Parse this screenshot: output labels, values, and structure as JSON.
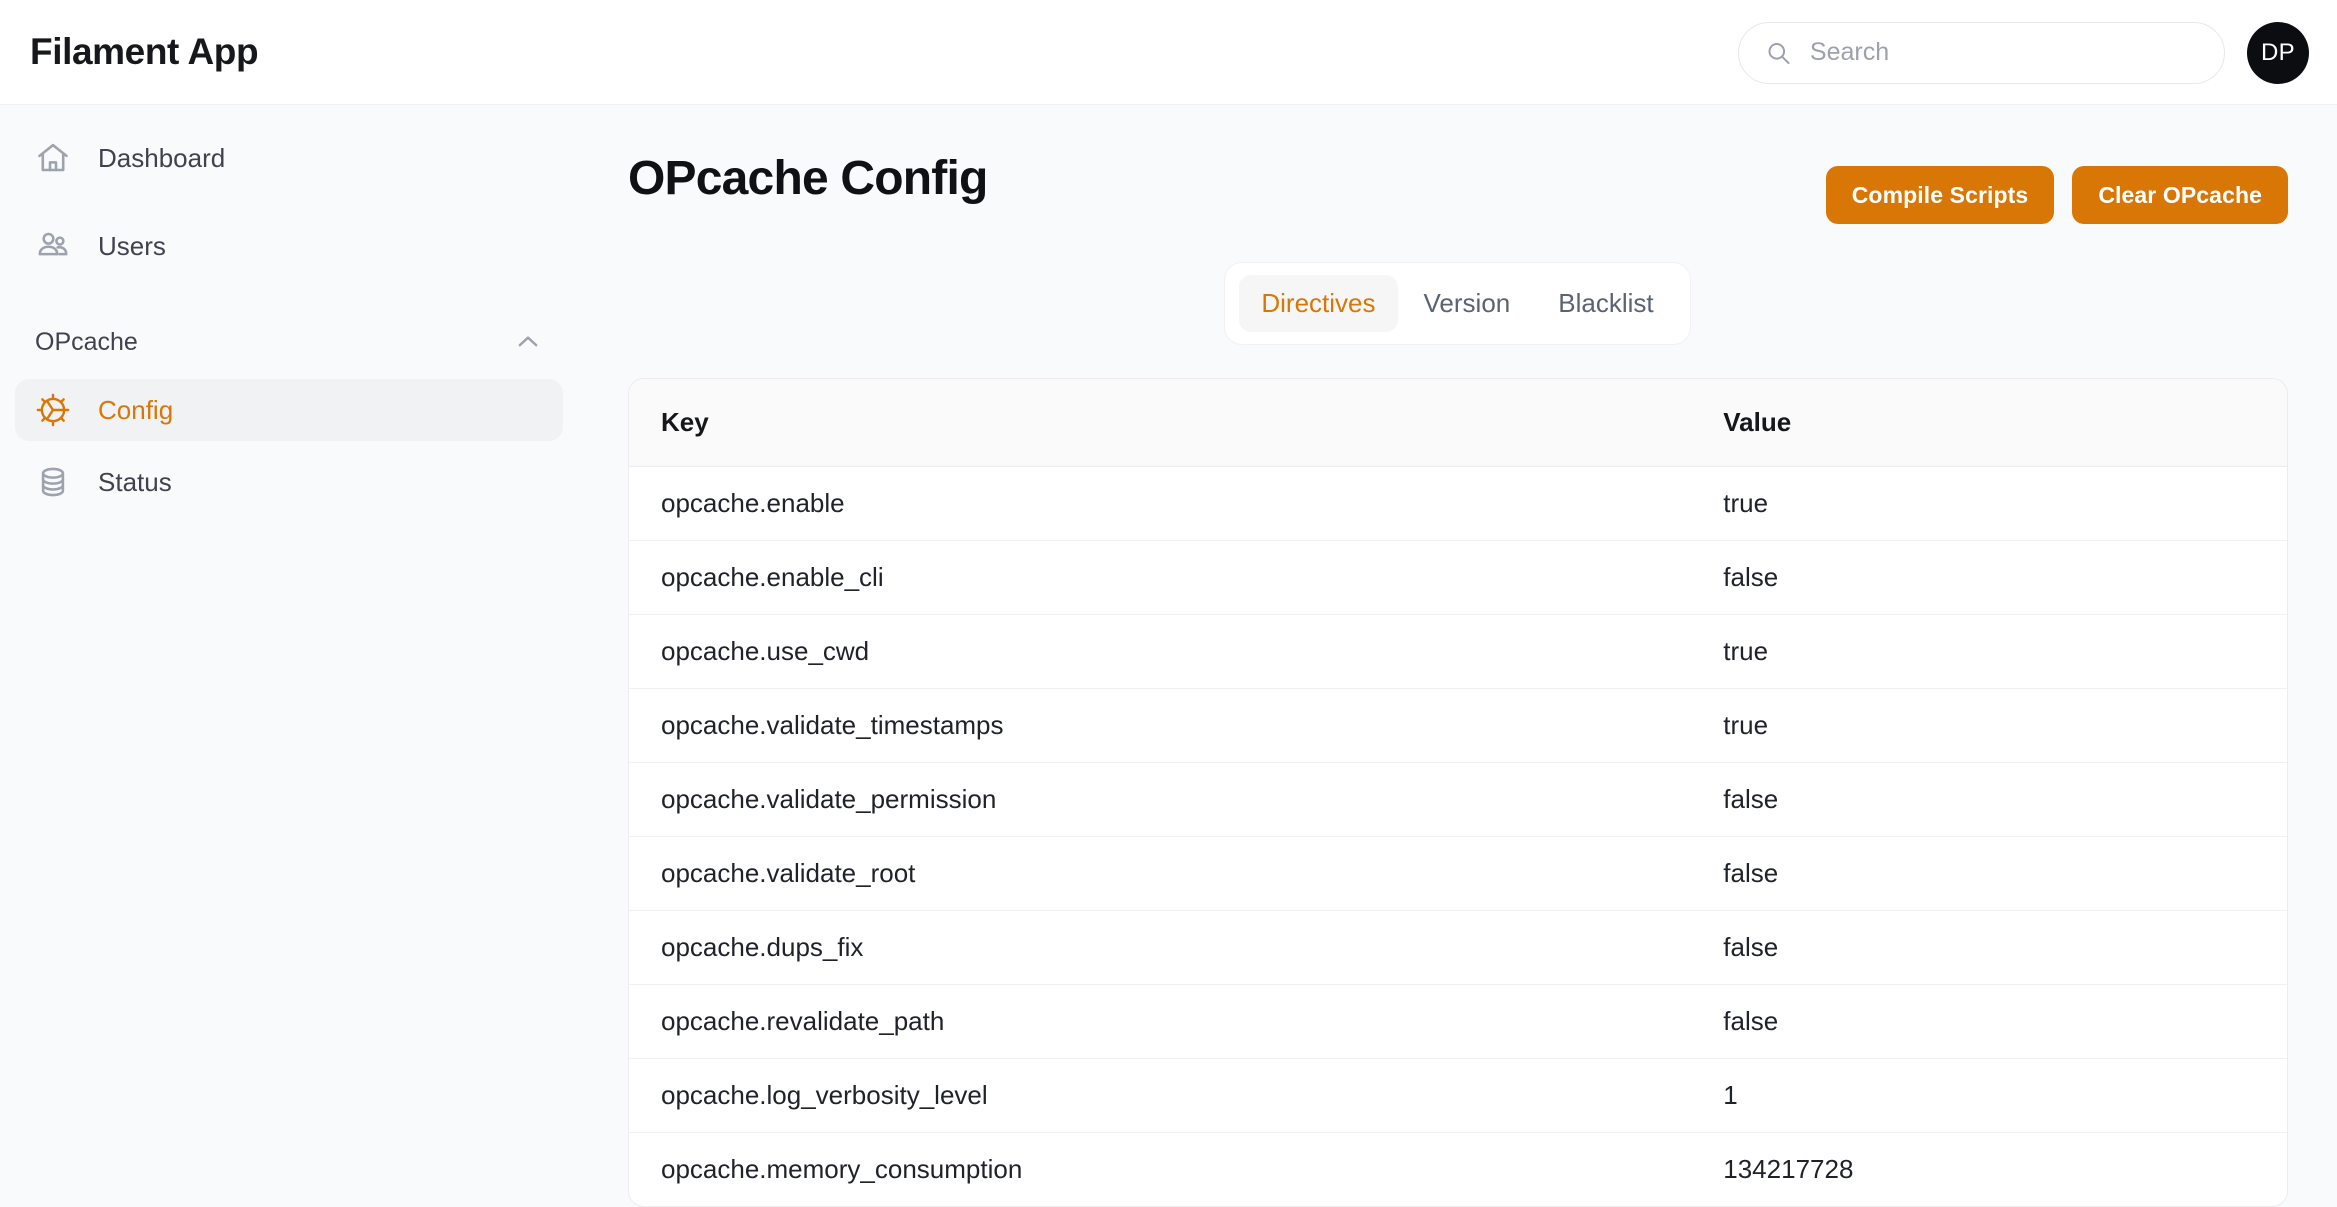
{
  "header": {
    "brand": "Filament App",
    "search": {
      "placeholder": "Search",
      "value": ""
    },
    "avatar": "DP"
  },
  "sidebar": {
    "items": [
      {
        "label": "Dashboard",
        "icon": "home-icon"
      },
      {
        "label": "Users",
        "icon": "users-icon"
      }
    ],
    "group": {
      "label": "OPcache",
      "collapse_icon": "chevron-up-icon",
      "items": [
        {
          "label": "Config",
          "icon": "cog-icon",
          "active": true
        },
        {
          "label": "Status",
          "icon": "database-icon",
          "active": false
        }
      ]
    }
  },
  "main": {
    "title": "OPcache Config",
    "actions": [
      {
        "label": "Compile Scripts"
      },
      {
        "label": "Clear OPcache"
      }
    ],
    "tabs": [
      {
        "label": "Directives",
        "active": true
      },
      {
        "label": "Version",
        "active": false
      },
      {
        "label": "Blacklist",
        "active": false
      }
    ],
    "table": {
      "columns": [
        "Key",
        "Value"
      ],
      "rows": [
        {
          "key": "opcache.enable",
          "value": "true"
        },
        {
          "key": "opcache.enable_cli",
          "value": "false"
        },
        {
          "key": "opcache.use_cwd",
          "value": "true"
        },
        {
          "key": "opcache.validate_timestamps",
          "value": "true"
        },
        {
          "key": "opcache.validate_permission",
          "value": "false"
        },
        {
          "key": "opcache.validate_root",
          "value": "false"
        },
        {
          "key": "opcache.dups_fix",
          "value": "false"
        },
        {
          "key": "opcache.revalidate_path",
          "value": "false"
        },
        {
          "key": "opcache.log_verbosity_level",
          "value": "1"
        },
        {
          "key": "opcache.memory_consumption",
          "value": "134217728"
        }
      ]
    }
  },
  "colors": {
    "accent": "#d97706",
    "page_bg": "#f9fafb",
    "surface": "#ffffff",
    "text": "#1f2228",
    "muted": "#9ca2ae"
  }
}
